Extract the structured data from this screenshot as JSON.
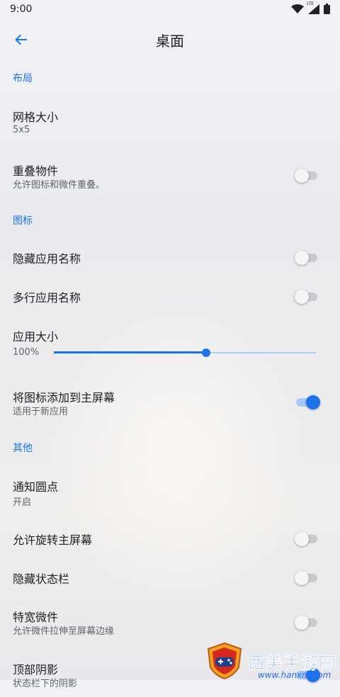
{
  "status_bar": {
    "time": "9:00",
    "network_label": "LTE"
  },
  "app_bar": {
    "title": "桌面"
  },
  "sections": {
    "layout": "布局",
    "icons": "图标",
    "other": "其他"
  },
  "settings": {
    "grid_size": {
      "title": "网格大小",
      "value": "5x5"
    },
    "overlap_widgets": {
      "title": "重叠物件",
      "subtitle": "允许图标和微件重叠。",
      "enabled": false
    },
    "hide_app_names": {
      "title": "隐藏应用名称",
      "enabled": false
    },
    "multiline_app_names": {
      "title": "多行应用名称",
      "enabled": false
    },
    "app_size": {
      "title": "应用大小",
      "value_label": "100%",
      "slider_fraction": 0.58
    },
    "add_icon_home": {
      "title": "将图标添加到主屏幕",
      "subtitle": "适用于新应用",
      "enabled": true
    },
    "notification_dots": {
      "title": "通知圆点",
      "value": "开启"
    },
    "allow_rotation": {
      "title": "允许旋转主屏幕",
      "enabled": false
    },
    "hide_status_bar": {
      "title": "隐藏状态栏",
      "enabled": false
    },
    "extra_wide_widgets": {
      "title": "特宽微件",
      "subtitle": "允许微件拉伸至屏幕边缘",
      "enabled": false
    },
    "top_shadow": {
      "title": "顶部阴影",
      "subtitle": "状态栏下的阴影",
      "enabled": true
    }
  },
  "watermark": {
    "text": "西美手游网",
    "url": "www.hanxm.com"
  },
  "colors": {
    "accent": "#1a73e8",
    "track_on": "#a8c7fa",
    "track_off": "#c9cbcf"
  }
}
